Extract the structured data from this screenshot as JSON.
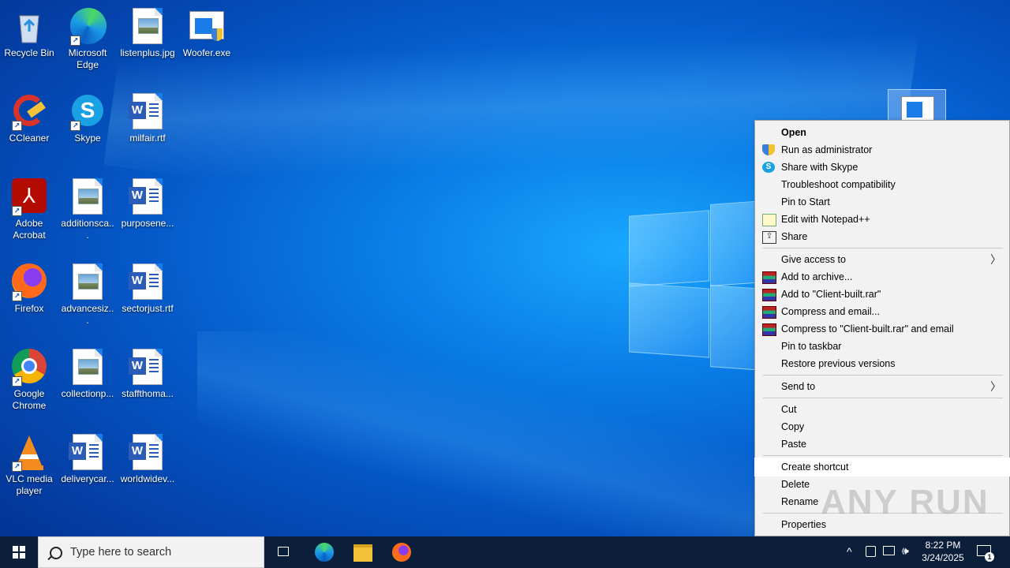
{
  "desktop": {
    "icons": [
      {
        "label": "Recycle Bin",
        "icon": "recycle-bin-icon"
      },
      {
        "label": "Microsoft Edge",
        "icon": "edge-icon"
      },
      {
        "label": "listenplus.jpg",
        "icon": "image-file-icon"
      },
      {
        "label": "Woofer.exe",
        "icon": "exe-file-icon"
      },
      {
        "label": "CCleaner",
        "icon": "ccleaner-icon"
      },
      {
        "label": "Skype",
        "icon": "skype-icon"
      },
      {
        "label": "milfair.rtf",
        "icon": "word-file-icon"
      },
      {
        "label": "Adobe Acrobat",
        "icon": "acrobat-icon"
      },
      {
        "label": "additionsca...",
        "icon": "image-file-icon"
      },
      {
        "label": "purposene...",
        "icon": "word-file-icon"
      },
      {
        "label": "Firefox",
        "icon": "firefox-icon"
      },
      {
        "label": "advancesiz...",
        "icon": "image-file-icon"
      },
      {
        "label": "sectorjust.rtf",
        "icon": "word-file-icon"
      },
      {
        "label": "Google Chrome",
        "icon": "chrome-icon"
      },
      {
        "label": "collectionp...",
        "icon": "image-file-icon"
      },
      {
        "label": "staffthoma...",
        "icon": "word-file-icon"
      },
      {
        "label": "VLC media player",
        "icon": "vlc-icon"
      },
      {
        "label": "deliverycar...",
        "icon": "word-file-icon"
      },
      {
        "label": "worldwidev...",
        "icon": "word-file-icon"
      }
    ]
  },
  "context_menu": {
    "items": [
      {
        "label": "Open"
      },
      {
        "label": "Run as administrator"
      },
      {
        "label": "Share with Skype"
      },
      {
        "label": "Troubleshoot compatibility"
      },
      {
        "label": "Pin to Start"
      },
      {
        "label": "Edit with Notepad++"
      },
      {
        "label": "Share"
      },
      {
        "label": "Give access to"
      },
      {
        "label": "Add to archive..."
      },
      {
        "label": "Add to \"Client-built.rar\""
      },
      {
        "label": "Compress and email..."
      },
      {
        "label": "Compress to \"Client-built.rar\" and email"
      },
      {
        "label": "Pin to taskbar"
      },
      {
        "label": "Restore previous versions"
      },
      {
        "label": "Send to"
      },
      {
        "label": "Cut"
      },
      {
        "label": "Copy"
      },
      {
        "label": "Paste"
      },
      {
        "label": "Create shortcut"
      },
      {
        "label": "Delete"
      },
      {
        "label": "Rename"
      },
      {
        "label": "Properties"
      }
    ],
    "highlighted": "Create shortcut"
  },
  "watermark": "ANY RUN",
  "taskbar": {
    "search_placeholder": "Type here to search",
    "pinned": [
      "task-view-icon",
      "edge-icon",
      "file-explorer-icon",
      "firefox-icon"
    ],
    "clock_time": "8:22 PM",
    "clock_date": "3/24/2025",
    "notification_count": "1"
  }
}
